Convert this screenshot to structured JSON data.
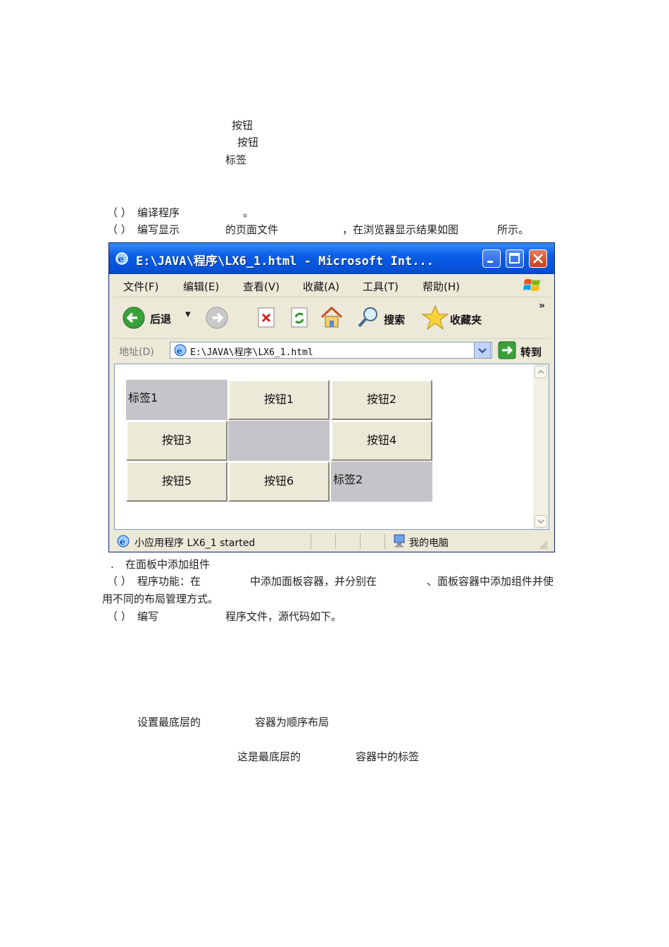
{
  "doc": {
    "line_btn1": "按钮",
    "line_btn2": "按钮",
    "line_label": "标签",
    "step_open": "（ ）",
    "step1_text": "编译程序",
    "step1_end": "。",
    "step2_text": "编写显示",
    "step2_mid": "的页面文件",
    "step2_tail": "，在浏览器显示结果如图",
    "step2_end": "所示。",
    "section_dot": ".",
    "section_title": "在面板中添加组件",
    "func_a": "程序功能：在",
    "func_b": "中添加面板容器，并分别在",
    "func_c": "、面板容器中添加组件并使",
    "func_d": "用不同的布局管理方式。",
    "write_a": "编写",
    "write_b": "程序文件，源代码如下。",
    "comment1_a": "设置最底层的",
    "comment1_b": "容器为顺序布局",
    "comment2_a": "这是最底层的",
    "comment2_b": "容器中的标签"
  },
  "browser": {
    "title": "E:\\JAVA\\程序\\LX6_1.html - Microsoft Int...",
    "menu": [
      "文件(F)",
      "编辑(E)",
      "查看(V)",
      "收藏(A)",
      "工具(T)",
      "帮助(H)"
    ],
    "toolbar": {
      "back": "后退",
      "search": "搜索",
      "favorites": "收藏夹",
      "more": "»"
    },
    "address_label": "地址(D)",
    "address_value": "E:\\JAVA\\程序\\LX6_1.html",
    "go_label": "转到",
    "applet": {
      "cells": [
        {
          "type": "label",
          "text": "标签1"
        },
        {
          "type": "button",
          "text": "按钮1"
        },
        {
          "type": "button",
          "text": "按钮2"
        },
        {
          "type": "button",
          "text": "按钮3"
        },
        {
          "type": "empty",
          "text": ""
        },
        {
          "type": "button",
          "text": "按钮4"
        },
        {
          "type": "button",
          "text": "按钮5"
        },
        {
          "type": "button",
          "text": "按钮6"
        },
        {
          "type": "label",
          "text": "标签2"
        }
      ]
    },
    "status_left": "小应用程序 LX6_1 started",
    "status_right": "我的电脑"
  }
}
